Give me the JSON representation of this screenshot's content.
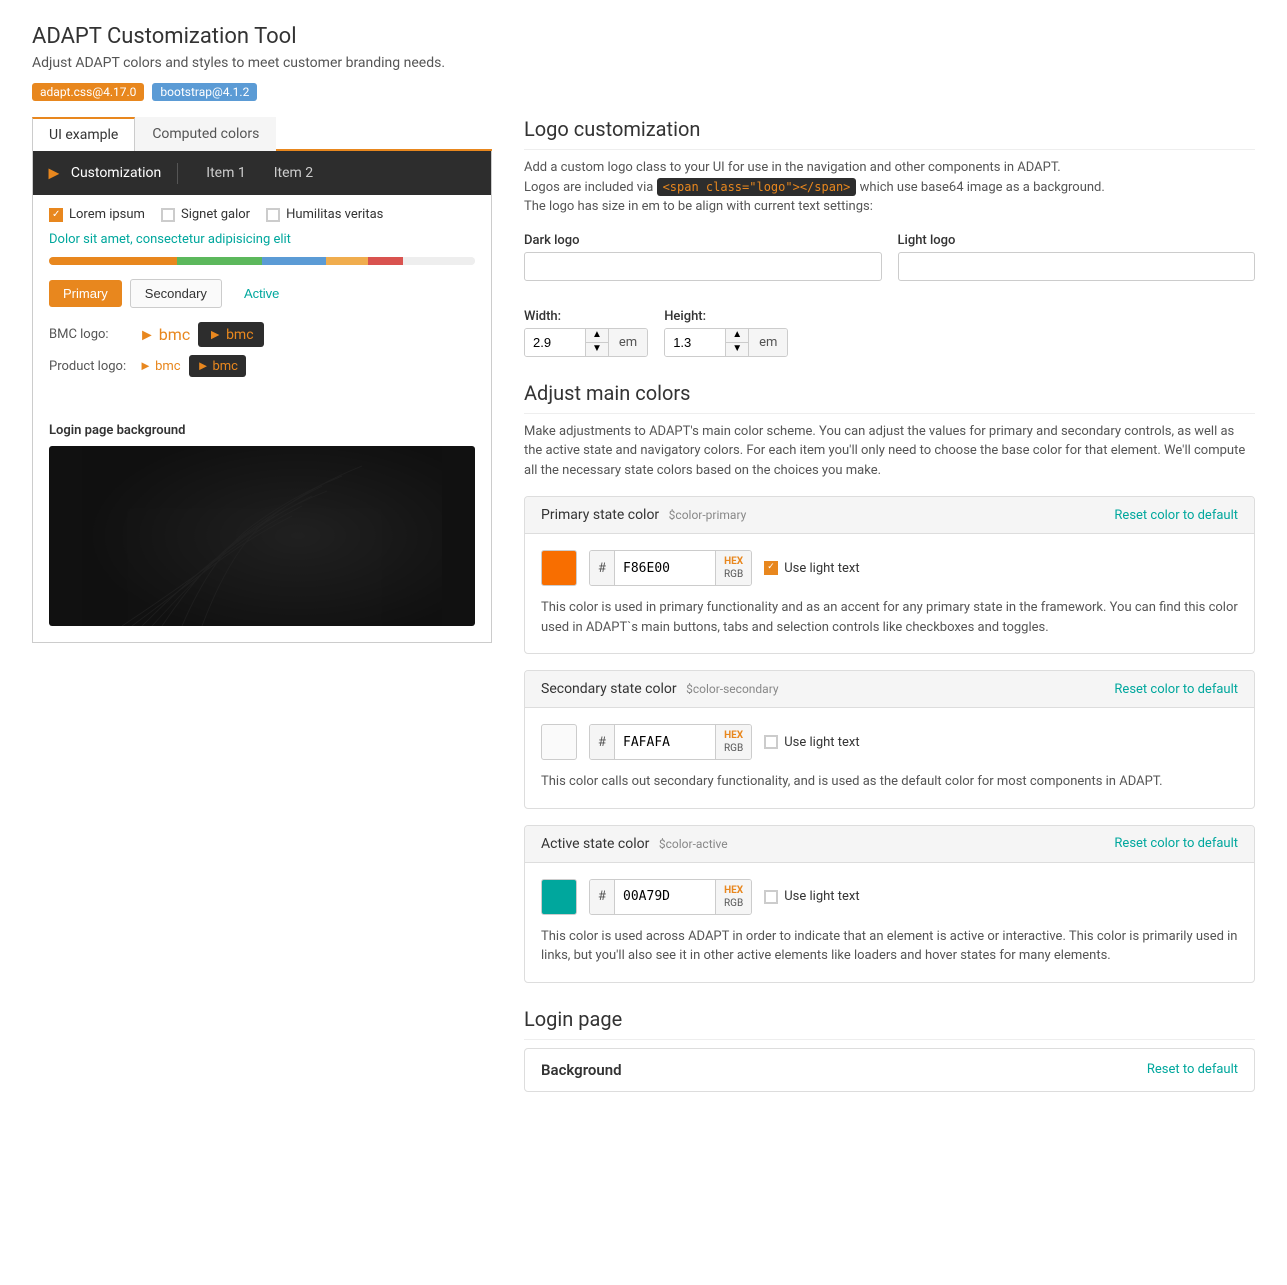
{
  "page": {
    "title": "ADAPT Customization Tool",
    "subtitle": "Adjust ADAPT colors and styles to meet customer branding needs.",
    "badges": [
      {
        "label": "adapt.css@4.17.0",
        "type": "orange"
      },
      {
        "label": "bootstrap@4.1.2",
        "type": "blue"
      }
    ]
  },
  "tabs": [
    {
      "label": "UI example",
      "active": true
    },
    {
      "label": "Computed colors",
      "active": false
    }
  ],
  "preview": {
    "nav": {
      "logo_text": "Customization",
      "items": [
        "Item 1",
        "Item 2"
      ]
    },
    "checkboxes": [
      {
        "label": "Lorem ipsum",
        "checked": true
      },
      {
        "label": "Signet galor",
        "checked": false
      },
      {
        "label": "Humilitas veritas",
        "checked": false
      }
    ],
    "link_text": "Dolor sit amet, consectetur adipisicing elit",
    "buttons": [
      {
        "label": "Primary",
        "type": "primary"
      },
      {
        "label": "Secondary",
        "type": "secondary"
      },
      {
        "label": "Active",
        "type": "active"
      }
    ],
    "logos": {
      "bmc_label": "BMC logo:",
      "product_label": "Product logo:"
    },
    "login_bg_label": "Login page background"
  },
  "logo_customization": {
    "title": "Logo customization",
    "desc1": "Add a custom logo class to your UI for use in the navigation and other components in ADAPT.",
    "desc2": "Logos are included via",
    "code_tag": "<span class=\"logo\"></span>",
    "desc3": "which use base64 image as a background.",
    "desc4": "The logo has size in em to be align with current text settings:",
    "dark_logo_label": "Dark logo",
    "light_logo_label": "Light logo",
    "dark_logo_value": "",
    "light_logo_value": "",
    "width_label": "Width:",
    "width_value": "2.9",
    "width_unit": "em",
    "height_label": "Height:",
    "height_value": "1.3",
    "height_unit": "em"
  },
  "adjust_colors": {
    "title": "Adjust main colors",
    "desc": "Make adjustments to ADAPT's main color scheme. You can adjust the values for primary and secondary controls, as well as the active state and navigatory colors. For each item you'll only need to choose the base color for that element. We'll compute all the necessary state colors based on the choices you make.",
    "sections": [
      {
        "id": "primary",
        "title": "Primary state color",
        "var": "$color-primary",
        "reset_label": "Reset color to default",
        "swatch_color": "#F86E00",
        "hex_value": "F86E00",
        "use_light_text": true,
        "use_light_text_label": "Use light text",
        "desc": "This color is used in primary functionality and as an accent for any primary state in the framework. You can find this color used in ADAPT`s main buttons, tabs and selection controls like checkboxes and toggles."
      },
      {
        "id": "secondary",
        "title": "Secondary state color",
        "var": "$color-secondary",
        "reset_label": "Reset color to default",
        "swatch_color": "#FAFAFA",
        "hex_value": "FAFAFA",
        "use_light_text": false,
        "use_light_text_label": "Use light text",
        "desc": "This color calls out secondary functionality, and is used as the default color for most components in ADAPT."
      },
      {
        "id": "active",
        "title": "Active state color",
        "var": "$color-active",
        "reset_label": "Reset color to default",
        "swatch_color": "#00A79D",
        "hex_value": "00A79D",
        "use_light_text": false,
        "use_light_text_label": "Use light text",
        "desc": "This color is used across ADAPT in order to indicate that an element is active or interactive. This color is primarily used in links, but you'll also see it in other active elements like loaders and hover states for many elements."
      }
    ]
  },
  "login_page": {
    "title": "Login page",
    "background_title": "Background",
    "reset_label": "Reset to default"
  }
}
